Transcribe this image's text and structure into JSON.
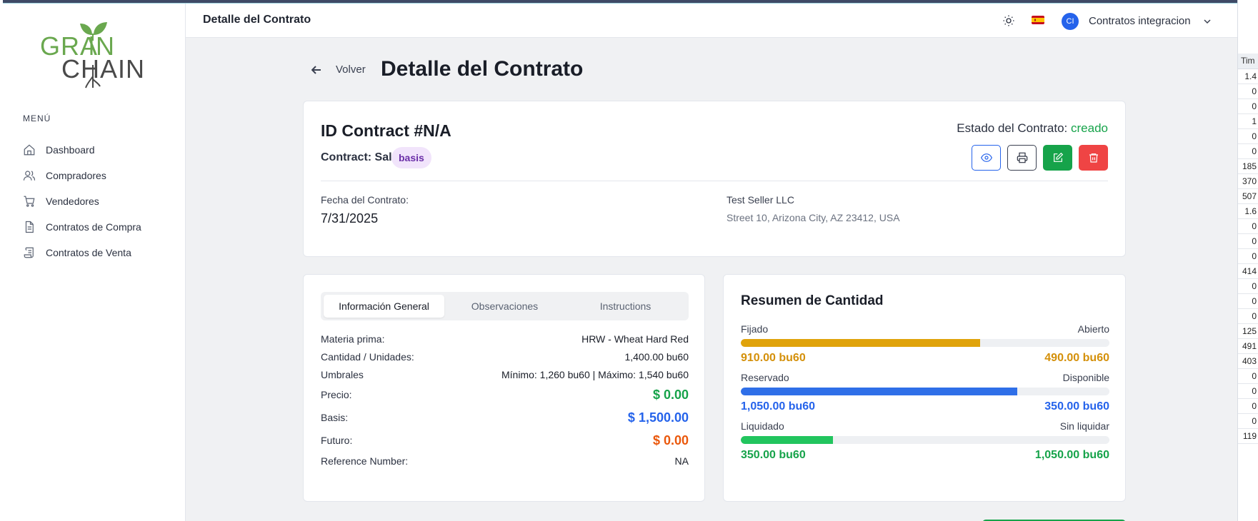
{
  "app": {
    "name": "Grain Chain"
  },
  "sidebar": {
    "menu_title": "MENÚ",
    "items": [
      {
        "label": "Dashboard",
        "icon": "home-icon"
      },
      {
        "label": "Compradores",
        "icon": "users-icon"
      },
      {
        "label": "Vendedores",
        "icon": "cart-icon"
      },
      {
        "label": "Contratos de Compra",
        "icon": "document-icon"
      },
      {
        "label": "Contratos de Venta",
        "icon": "scroll-icon"
      }
    ]
  },
  "topbar": {
    "title": "Detalle del Contrato",
    "avatar_initials": "CI",
    "user_name": "Contratos integracion"
  },
  "page": {
    "back_label": "Volver",
    "title": "Detalle del Contrato"
  },
  "contract": {
    "id_label": "ID Contract #N/A",
    "type_label": "Contract: Sale",
    "badge": "basis",
    "status_label": "Estado del Contrato: ",
    "status_value": "creado",
    "date_label": "Fecha del Contrato:",
    "date_value": "7/31/2025",
    "seller_name": "Test Seller LLC",
    "seller_address": "Street 10, Arizona City, AZ 23412, USA"
  },
  "tabs": [
    "Información General",
    "Observaciones",
    "Instructions"
  ],
  "info": {
    "materia_label": "Materia prima:",
    "materia_value": "HRW - Wheat Hard Red",
    "cantidad_label": "Cantidad / Unidades:",
    "cantidad_value": "1,400.00 bu60",
    "umbrales_label": "Umbrales",
    "umbrales_value": "Mínimo: 1,260 bu60 | Máximo: 1,540 bu60",
    "precio_label": "Precio:",
    "precio_value": "$ 0.00",
    "basis_label": "Basis:",
    "basis_value": "$ 1,500.00",
    "futuro_label": "Futuro:",
    "futuro_value": "$ 0.00",
    "ref_label": "Reference Number:",
    "ref_value": "NA"
  },
  "summary": {
    "title": "Resumen de Cantidad",
    "blocks": [
      {
        "left_label": "Fijado",
        "right_label": "Abierto",
        "left_value": "910.00 bu60",
        "right_value": "490.00 bu60",
        "fraction": 0.65,
        "color": "#e0a30b",
        "value_color": "#d4900a"
      },
      {
        "left_label": "Reservado",
        "right_label": "Disponible",
        "left_value": "1,050.00 bu60",
        "right_value": "350.00 bu60",
        "fraction": 0.75,
        "color": "#2f6fe8",
        "value_color": "#2563eb"
      },
      {
        "left_label": "Liquidado",
        "right_label": "Sin liquidar",
        "left_value": "350.00 bu60",
        "right_value": "1,050.00 bu60",
        "fraction": 0.25,
        "color": "#22c55e",
        "value_color": "#16a34a"
      }
    ]
  },
  "background": {
    "right_header": "Tim",
    "right_cells": [
      "1.4",
      "0",
      "0",
      "1",
      "0",
      "0",
      "185",
      "370",
      "507",
      "1.6",
      "0",
      "0",
      "0",
      "414",
      "0",
      "0",
      "0",
      "125",
      "491",
      "403",
      "0",
      "0",
      "0",
      "0",
      "119"
    ]
  }
}
